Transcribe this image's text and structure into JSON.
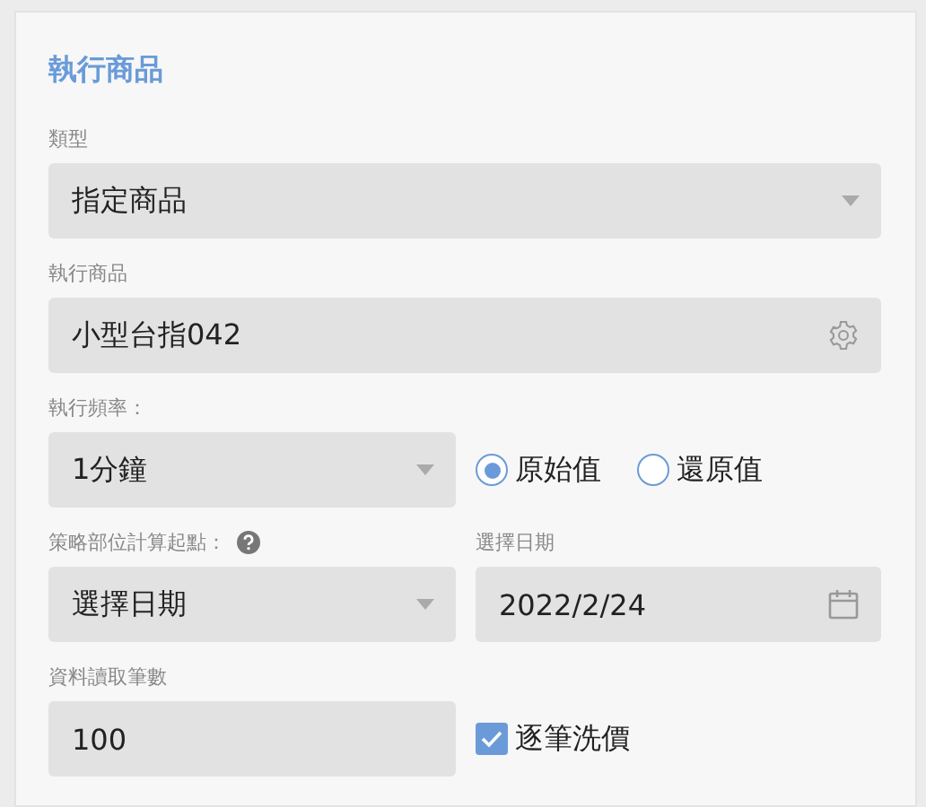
{
  "section_title": "執行商品",
  "type_field": {
    "label": "類型",
    "value": "指定商品"
  },
  "product_field": {
    "label": "執行商品",
    "value": "小型台指042"
  },
  "frequency_field": {
    "label": "執行頻率：",
    "value": "1分鐘"
  },
  "price_mode": [
    {
      "label": "原始值",
      "selected": true
    },
    {
      "label": "還原值",
      "selected": false
    }
  ],
  "start_point_field": {
    "label": "策略部位計算起點：",
    "value": "選擇日期"
  },
  "date_field": {
    "label": "選擇日期",
    "value": "2022/2/24"
  },
  "record_count_field": {
    "label": "資料讀取筆數",
    "value": "100"
  },
  "tick_cleaning": {
    "label": "逐筆洗價",
    "checked": true
  }
}
